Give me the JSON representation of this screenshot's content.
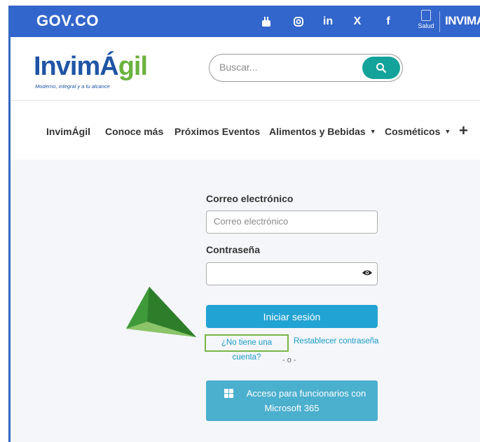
{
  "govbar": {
    "logo_text": "GOV.CO",
    "social": [
      "youtube-icon",
      "instagram-icon",
      "linkedin-icon",
      "x-icon",
      "facebook-icon"
    ],
    "social_glyphs": [
      "▣",
      "◎",
      "in",
      "X",
      "f"
    ],
    "salud_label": "Salud",
    "invima_label": "INVIMA"
  },
  "header": {
    "logo_blue": "InvimÁ",
    "logo_green": "gil",
    "logo_tagline": "Moderno, integral y a tu alcance",
    "search_placeholder": "Buscar..."
  },
  "nav": {
    "items": [
      "InvimÁgil",
      "Conoce más",
      "Próximos Eventos",
      "Alimentos y Bebidas",
      "Cosméticos"
    ],
    "more": "+"
  },
  "form": {
    "email_label": "Correo electrónico",
    "email_placeholder": "Correo electrónico",
    "password_label": "Contraseña",
    "login_button": "Iniciar sesión",
    "no_account_link": "¿No tiene una cuenta?",
    "reset_link": "Restablecer contraseña",
    "separator": "- o -",
    "ms_button_line1": "Acceso para funcionarios con",
    "ms_button_line2": "Microsoft 365"
  },
  "colors": {
    "gov_blue": "#3366cc",
    "teal": "#14a39b",
    "login_blue": "#21a3d3",
    "ms_blue": "#4bafce",
    "highlight_green": "#7ab648"
  }
}
